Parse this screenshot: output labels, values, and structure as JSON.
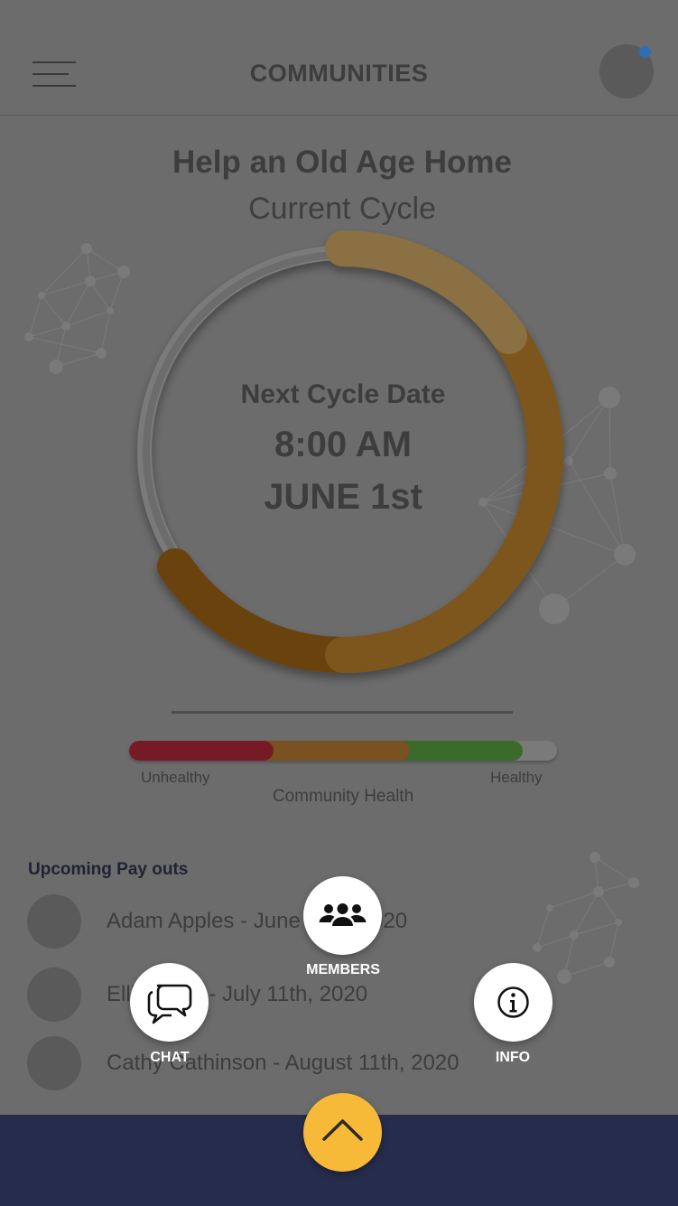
{
  "header": {
    "title": "COMMUNITIES"
  },
  "community": {
    "name": "Help an Old Age Home",
    "cycle_label": "Current Cycle"
  },
  "cycle": {
    "label": "Next Cycle Date",
    "time": "8:00 AM",
    "date": "JUNE 1st",
    "progress_fraction": 0.62
  },
  "health": {
    "low_label": "Unhealthy",
    "high_label": "Healthy",
    "caption": "Community Health",
    "segments": [
      {
        "level": "unhealthy",
        "color": "#761b25"
      },
      {
        "level": "moderate",
        "color": "#7a5121"
      },
      {
        "level": "healthy",
        "color": "#3b6b2a"
      }
    ]
  },
  "payouts": {
    "title": "Upcoming Pay outs",
    "items": [
      {
        "text": "Adam Apples - June 11th, 2020"
      },
      {
        "text": "Ellie Eggs - July 11th, 2020"
      },
      {
        "text": "Cathy Cathinson - August 11th, 2020"
      }
    ]
  },
  "actions": {
    "members_label": "MEMBERS",
    "chat_label": "CHAT",
    "info_label": "INFO",
    "members_icon": "group-icon",
    "chat_icon": "chat-bubbles-icon",
    "info_icon": "info-icon",
    "toggle_icon": "chevron-up-icon"
  },
  "colors": {
    "overlay": "#6c6c6c",
    "bottom_bar": "#262d4c",
    "accent": "#f7b938",
    "notification_dot": "#2c6fb3",
    "ring_gold": "#8a6422",
    "ring_dark": "#6a430d"
  }
}
